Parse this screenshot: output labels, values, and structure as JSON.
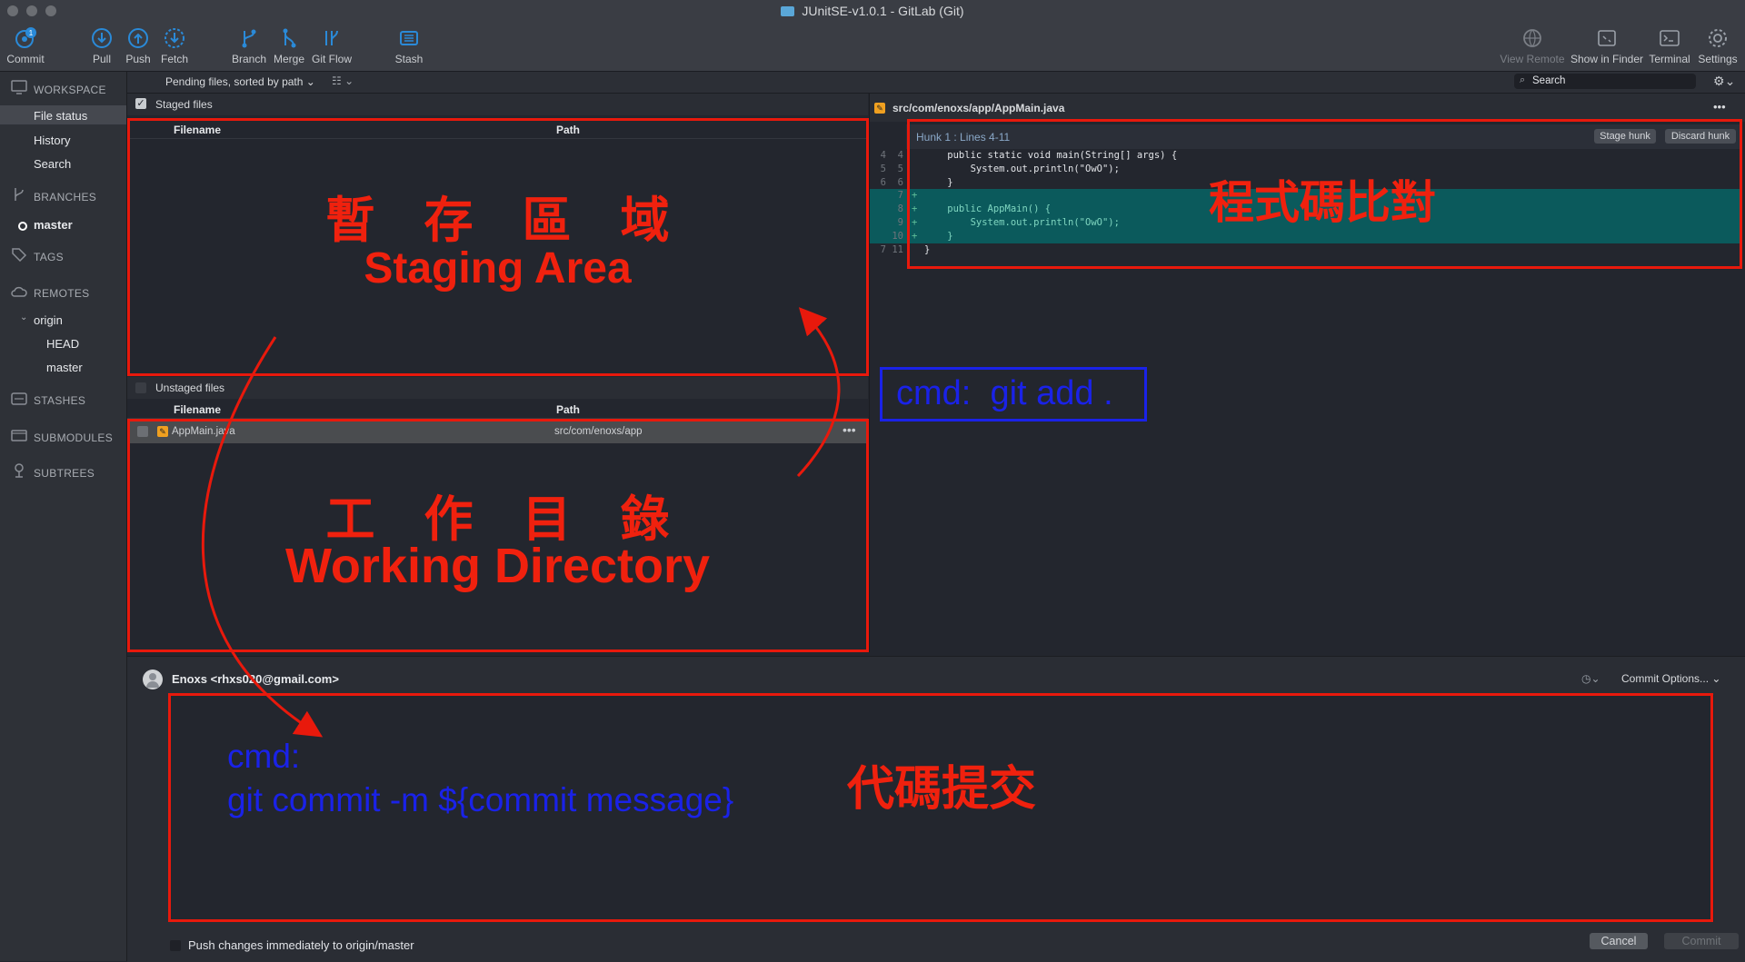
{
  "window": {
    "title": "JUnitSE-v1.0.1 - GitLab (Git)"
  },
  "toolbar": {
    "commit": "Commit",
    "commit_badge": "1",
    "pull": "Pull",
    "push": "Push",
    "fetch": "Fetch",
    "branch": "Branch",
    "merge": "Merge",
    "gitflow": "Git Flow",
    "stash": "Stash",
    "view_remote": "View Remote",
    "show_in_finder": "Show in Finder",
    "terminal": "Terminal",
    "settings": "Settings"
  },
  "sidebar": {
    "workspace": "WORKSPACE",
    "file_status": "File status",
    "history": "History",
    "search": "Search",
    "branches": "BRANCHES",
    "master": "master",
    "tags": "TAGS",
    "remotes": "REMOTES",
    "origin": "origin",
    "head": "HEAD",
    "origin_master": "master",
    "stashes": "STASHES",
    "submodules": "SUBMODULES",
    "subtrees": "SUBTREES"
  },
  "filter": {
    "sort": "Pending files, sorted by path",
    "search_placeholder": "Search"
  },
  "staged": {
    "title": "Staged files",
    "col_filename": "Filename",
    "col_path": "Path"
  },
  "unstaged": {
    "title": "Unstaged files",
    "col_filename": "Filename",
    "col_path": "Path",
    "files": [
      {
        "name": "AppMain.java",
        "path": "src/com/enoxs/app"
      }
    ]
  },
  "diff": {
    "file": "src/com/enoxs/app/AppMain.java",
    "hunk_title": "Hunk 1 : Lines 4-11",
    "stage_hunk": "Stage hunk",
    "discard_hunk": "Discard hunk",
    "lines": [
      {
        "old": "4",
        "new": "4",
        "sign": "",
        "text": "    public static void main(String[] args) {",
        "added": false
      },
      {
        "old": "5",
        "new": "5",
        "sign": "",
        "text": "        System.out.println(\"OwO\");",
        "added": false
      },
      {
        "old": "6",
        "new": "6",
        "sign": "",
        "text": "    }",
        "added": false
      },
      {
        "old": "",
        "new": "7",
        "sign": "+",
        "text": "",
        "added": true
      },
      {
        "old": "",
        "new": "8",
        "sign": "+",
        "text": "    public AppMain() {",
        "added": true
      },
      {
        "old": "",
        "new": "9",
        "sign": "+",
        "text": "        System.out.println(\"OwO\");",
        "added": true
      },
      {
        "old": "",
        "new": "10",
        "sign": "+",
        "text": "    }",
        "added": true
      },
      {
        "old": "7",
        "new": "11",
        "sign": "",
        "text": "}",
        "added": false
      }
    ]
  },
  "commit": {
    "author": "Enoxs <rhxs020@gmail.com>",
    "options": "Commit Options...",
    "push_immediately": "Push changes immediately to origin/master",
    "cancel": "Cancel",
    "commit": "Commit"
  },
  "annotations": {
    "staging_zh": "暫　存　區　域",
    "staging_en": "Staging Area",
    "working_zh": "工　作　目　錄",
    "working_en": "Working Directory",
    "diff_zh": "程式碼比對",
    "commit_zh": "代碼提交",
    "git_add": "cmd:  git add .",
    "cmd_label": "cmd:",
    "git_commit": "git commit -m ${commit message}"
  },
  "colors": {
    "annotation_red": "#f0210e",
    "annotation_blue": "#1a22e8",
    "added_line_bg": "#0b5a5c",
    "accent": "#2a8ad8"
  }
}
